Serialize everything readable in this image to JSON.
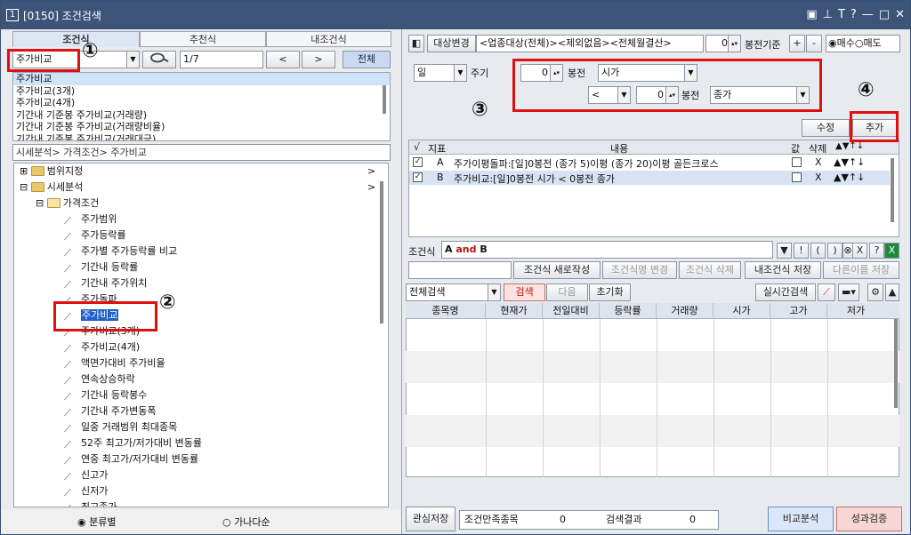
{
  "window": {
    "num": "1",
    "title": "[0150] 조건검색",
    "controls": [
      "▣",
      "⊥",
      "T",
      "?",
      "—",
      "□",
      "✕"
    ]
  },
  "left": {
    "tabs": [
      "조건식",
      "추천식",
      "내조건식"
    ],
    "search_value": "주가비교",
    "page": "1/7",
    "prev": "<",
    "next": ">",
    "all": "전체",
    "results": [
      "주가비교",
      "주가비교(3개)",
      "주가비교(4개)",
      "기간내 기준봉 주가비교(거래량)",
      "기간내 기준봉 주가비교(거래량비율)",
      "기간내 기준봉 주가비교(거래대금)"
    ],
    "path": "시세분석> 가격조건> 주가비교",
    "tree": {
      "n1": "범위지정",
      "n2": "시세분석",
      "n3": "가격조건",
      "leaves": [
        "주가범위",
        "주가등락률",
        "주가별 주가등락률 비교",
        "기간내 등락률",
        "기간내 주가위치",
        "주가돌파",
        "주가비교",
        "주가비교(3개)",
        "주가비교(4개)",
        "액면가대비 주가비율",
        "연속상승하락",
        "기간내 등락봉수",
        "기간내 주가변동폭",
        "일중 거래범위 최대종목",
        "52주 최고가/저가대비 변동률",
        "연중 최고가/저가대비 변동률",
        "신고가",
        "신저가",
        "최고종가"
      ]
    },
    "radio1": "분류별",
    "radio2": "가나다순"
  },
  "right": {
    "target_btn": "대상변경",
    "target_text": "<업종대상(전체)><제외없음><전체월결산>",
    "base_val": "0",
    "base_label": "봉전기준",
    "plus": "+",
    "minus": "-",
    "buy": "매수",
    "sell": "매도",
    "period_val": "일",
    "period_label": "주기",
    "c1_val": "0",
    "c1_label": "봉전",
    "c1_sel": "시가",
    "op": "<",
    "c2_val": "0",
    "c2_label": "봉전",
    "c2_sel": "종가",
    "edit": "수정",
    "add": "추가",
    "cond_headers": [
      "√",
      "지표",
      "내용",
      "값",
      "삭제",
      "▲▼↑↓"
    ],
    "conds": [
      {
        "id": "A",
        "text": "주가이평돌파:[일]0봉전 (종가 5)이평 (종가 20)이평 골든크로스",
        "del": "X"
      },
      {
        "id": "B",
        "text": "주가비교:[일]0봉전 시가 < 0봉전 종가",
        "del": "X"
      }
    ],
    "expr_label": "조건식",
    "expr_a": "A",
    "expr_and": "and",
    "expr_b": "B",
    "ops": [
      "▼",
      "!",
      "(",
      ")",
      "⊗",
      "X",
      "?"
    ],
    "btns": [
      "조건식 새로작성",
      "조건식명 변경",
      "조건식 삭제",
      "내조건식 저장",
      "다른이름 저장"
    ],
    "scope": "전체검색",
    "search": "검색",
    "next": "다음",
    "reset": "초기화",
    "realtime": "실시간검색",
    "grid_headers": [
      "종목명",
      "현재가",
      "전일대비",
      "등락률",
      "거래량",
      "시가",
      "고가",
      "저가"
    ],
    "save": "관심저장",
    "match_label": "조건만족종목",
    "match_val": "0",
    "result_label": "검색결과",
    "result_val": "0",
    "compare": "비교분석",
    "verify": "성과검증"
  },
  "annotations": [
    "①",
    "②",
    "③",
    "④"
  ]
}
